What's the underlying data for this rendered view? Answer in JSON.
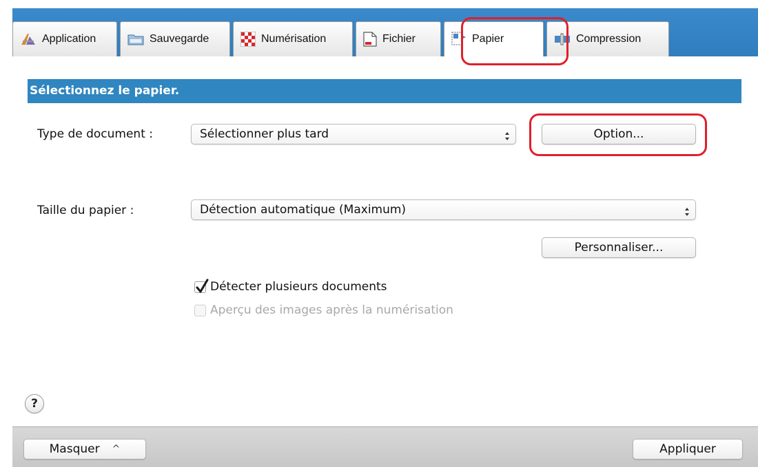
{
  "tabs": [
    {
      "label": "Application",
      "icon": "application-icon",
      "active": false
    },
    {
      "label": "Sauvegarde",
      "icon": "folder-icon",
      "active": false
    },
    {
      "label": "Numérisation",
      "icon": "scan-checker-icon",
      "active": false
    },
    {
      "label": "Fichier",
      "icon": "file-icon",
      "active": false
    },
    {
      "label": "Papier",
      "icon": "paper-icon",
      "active": true
    },
    {
      "label": "Compression",
      "icon": "compression-icon",
      "active": false
    }
  ],
  "section": {
    "title": "Sélectionnez le papier."
  },
  "document_type": {
    "label": "Type de document :",
    "value": "Sélectionner plus tard",
    "option_button": "Option..."
  },
  "paper_size": {
    "label": "Taille du papier :",
    "value": "Détection automatique (Maximum)",
    "custom_button": "Personnaliser..."
  },
  "checkboxes": {
    "multifeed": {
      "label": "Détecter plusieurs documents",
      "checked": true,
      "enabled": true
    },
    "preview": {
      "label": "Aperçu des images après la numérisation",
      "checked": false,
      "enabled": false
    }
  },
  "help": {
    "symbol": "?"
  },
  "bottom": {
    "hide_button": "Masquer",
    "hide_chevron": "^",
    "apply_button": "Appliquer"
  },
  "colors": {
    "header_blue": "#2f86c0",
    "tab_bar_blue": "#3a89cb",
    "callout_red": "#e0202a"
  }
}
